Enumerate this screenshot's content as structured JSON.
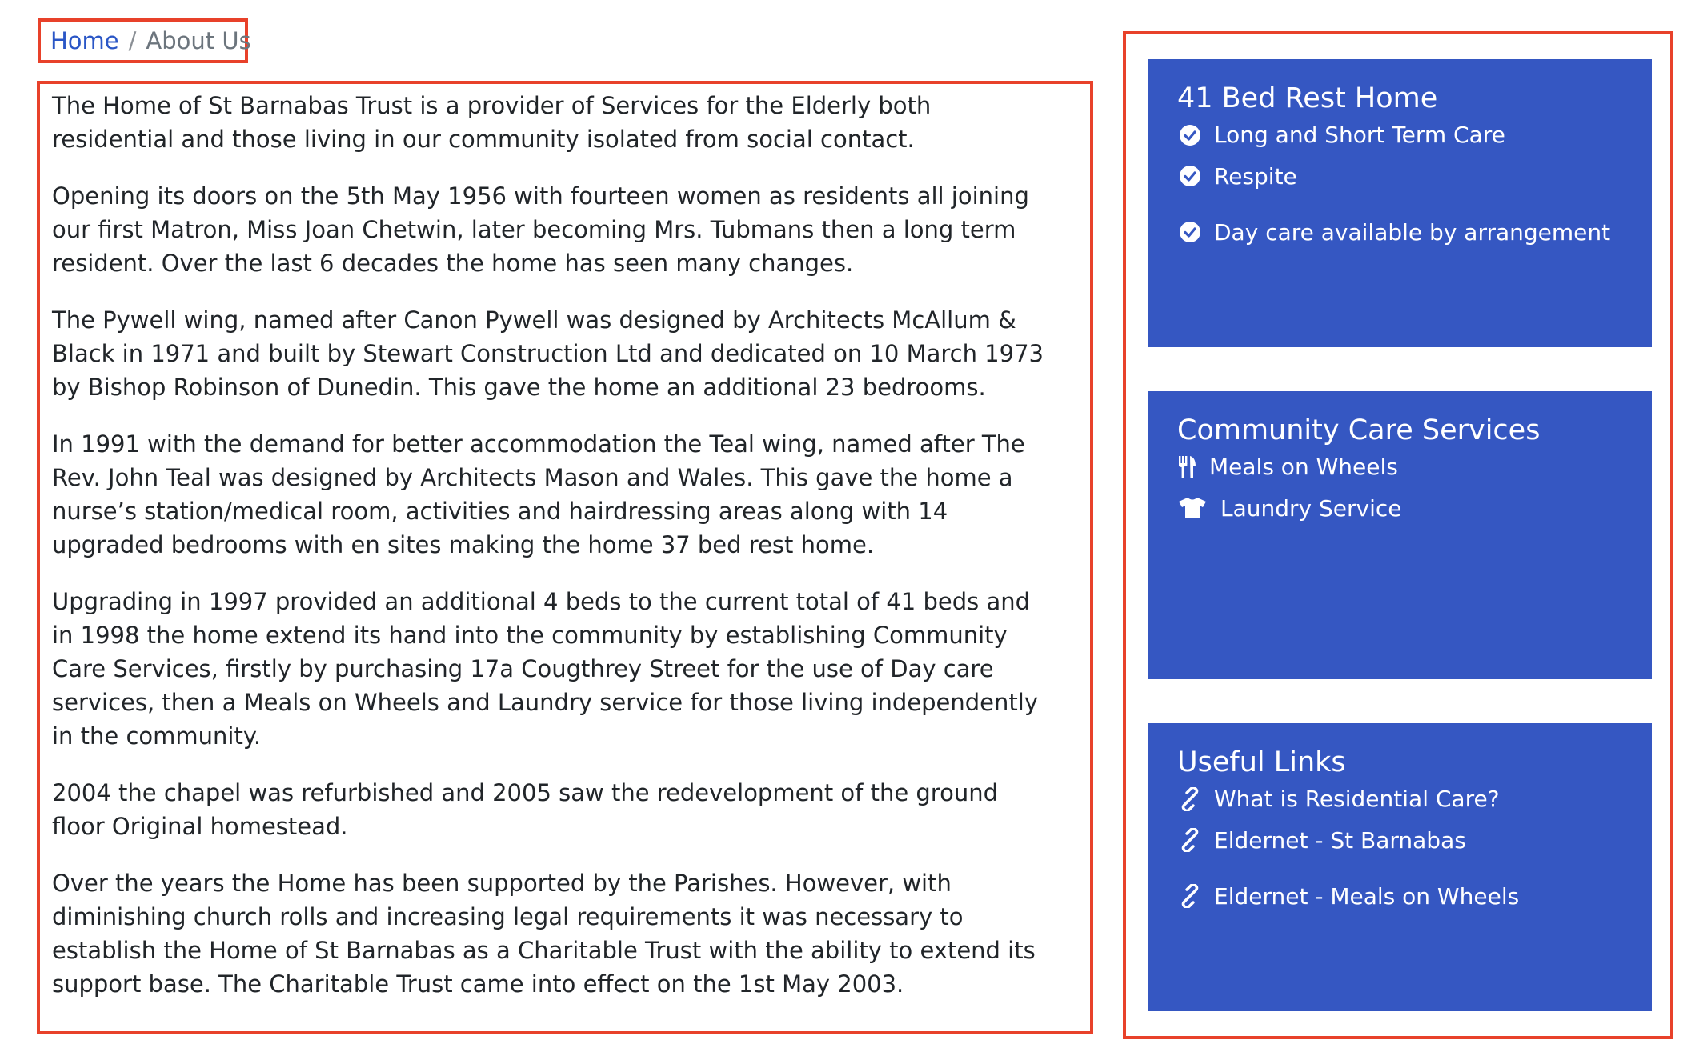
{
  "breadcrumb": {
    "home": "Home",
    "separator": "/",
    "current": "About Us"
  },
  "content": {
    "paragraphs": [
      "The Home of St Barnabas Trust is a provider of Services for the Elderly both residential and those living in our community isolated from social contact.",
      "Opening its doors on the 5th May 1956 with fourteen women as residents all joining our first Matron, Miss Joan Chetwin, later becoming Mrs. Tubmans then a long term resident. Over the last 6 decades the home has seen many changes.",
      "The Pywell wing, named after Canon Pywell was designed by Architects McAllum & Black in 1971 and built by Stewart Construction Ltd and dedicated on 10 March 1973 by Bishop Robinson of Dunedin. This gave the home an additional 23 bedrooms.",
      "In 1991 with the demand for better accommodation the Teal wing, named after The Rev. John Teal was designed by Architects Mason and Wales. This gave the home a nurse’s station/medical room, activities and hairdressing areas along with 14 upgraded bedrooms with en sites making the home 37 bed rest home.",
      "Upgrading in 1997 provided an additional 4 beds to the current total of 41 beds and in 1998 the home extend its hand into the community by establishing Community Care Services, firstly by purchasing 17a Cougthrey Street for the use of Day care services, then a Meals on Wheels and Laundry service for those living independently in the community.",
      "2004 the chapel was refurbished and 2005 saw the redevelopment of the ground floor Original homestead.",
      "Over the years the Home has been supported by the Parishes. However, with diminishing church rolls and increasing legal requirements it was necessary to establish the Home of St Barnabas as a Charitable Trust with the ability to extend its support base. The Charitable Trust came into effect on the 1st May 2003."
    ]
  },
  "sidebar": {
    "panel_color": "#3557c2",
    "highlight_color": "#e8412a",
    "rest_home": {
      "title": "41 Bed Rest Home",
      "items": [
        {
          "label": "Long and Short Term Care",
          "icon": "check-circle-icon"
        },
        {
          "label": "Respite",
          "icon": "check-circle-icon"
        },
        {
          "label": "Day care available by arrangement",
          "icon": "check-circle-icon"
        }
      ]
    },
    "community": {
      "title": "Community Care Services",
      "items": [
        {
          "label": "Meals on Wheels",
          "icon": "utensils-icon"
        },
        {
          "label": "Laundry Service",
          "icon": "tshirt-icon"
        }
      ]
    },
    "links": {
      "title": "Useful Links",
      "items": [
        {
          "label": "What is Residential Care?",
          "icon": "link-icon"
        },
        {
          "label": "Eldernet - St Barnabas",
          "icon": "link-icon"
        },
        {
          "label": "Eldernet - Meals on Wheels",
          "icon": "link-icon"
        }
      ]
    }
  }
}
